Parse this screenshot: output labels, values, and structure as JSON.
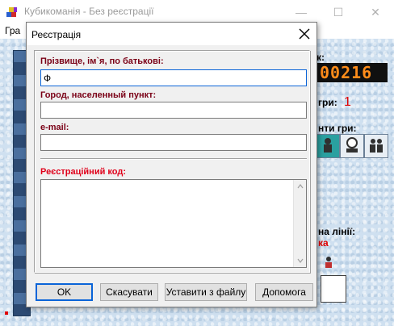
{
  "window": {
    "title": "Кубикоманія - Без реєстрації",
    "menu": [
      "Гра"
    ]
  },
  "game_panel": {
    "score_label": "к:",
    "score_digits": "00216",
    "level_label": "гри:",
    "level_value": "1",
    "variants_label": "нти гри:",
    "line_label": "на лінії:",
    "line_value": "ка"
  },
  "dialog": {
    "title": "Реєстрація",
    "fields": {
      "name_label": "Прізвище, ім`я, по батькові:",
      "name_value": "Ф",
      "city_label": "Город, населенный пункт:",
      "city_value": "",
      "email_label": "e-mail:",
      "email_value": "",
      "code_label": "Реєстраційний код:",
      "code_value": ""
    },
    "buttons": {
      "ok": "OK",
      "cancel": "Скасувати",
      "paste": "Уставити з файлу",
      "help": "Допомога"
    }
  },
  "colors": {
    "label_dark_red": "#7a0016",
    "label_red": "#e0001a",
    "score_orange": "#ff8c1a",
    "focus_blue": "#0a64d8"
  }
}
